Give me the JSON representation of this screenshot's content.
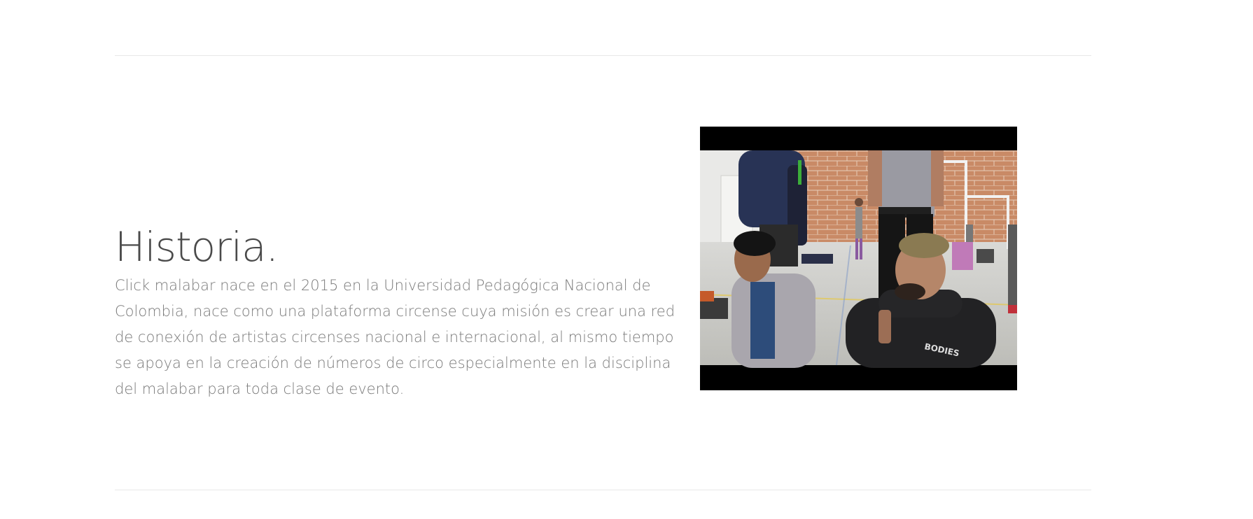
{
  "section": {
    "title": "Historia.",
    "body": "Click malabar nace en el 2015 en la Universidad Pedagógica Nacional de Colombia, nace como una plataforma circense cuya misión es crear una red de conexión de artistas circenses nacional e internacional, al mismo tiempo se apoya en la creación de números de circo especialmente en la disciplina del malabar para toda clase de evento."
  },
  "video": {
    "jersey_text": "BODIES"
  },
  "colors": {
    "title": "#4a4a4a",
    "body": "#7a7a7a",
    "divider": "#e8e8e8",
    "letterbox": "#000000"
  }
}
